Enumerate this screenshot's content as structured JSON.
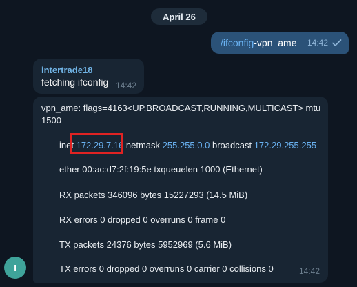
{
  "date_separator": "April 26",
  "outgoing_message": {
    "command_link": "/ifconfig",
    "command_rest": "-vpn_ame",
    "time": "14:42",
    "status_icon": "double-check-icon"
  },
  "incoming_message_1": {
    "sender": "intertrade18",
    "text": "fetching ifconfig",
    "time": "14:42"
  },
  "incoming_message_2": {
    "line1": "vpn_ame: flags=4163<UP,BROADCAST,RUNNING,MULTICAST>  mtu",
    "line2": "1500",
    "inet_label": "inet",
    "inet_ip": "172.29.7.16",
    "netmask_label": "netmask",
    "netmask_ip": "255.255.0.0",
    "broadcast_label": "broadcast",
    "broadcast_ip": "172.29.255.255",
    "ether_line": "ether 00:ac:d7:2f:19:5e  txqueuelen 1000  (Ethernet)",
    "rx_packets_line": "RX packets 346096  bytes 15227293 (14.5 MiB)",
    "rx_errors_line": "RX errors 0  dropped 0  overruns 0  frame 0",
    "tx_packets_line": "TX packets 24376  bytes 5952969 (5.6 MiB)",
    "tx_errors_line": "TX errors 0  dropped 0 overruns 0  carrier 0  collisions 0",
    "time": "14:42"
  },
  "avatar": {
    "initial": "I",
    "color": "#3fa39a"
  },
  "colors": {
    "background": "#0e1621",
    "incoming_bubble": "#182533",
    "outgoing_bubble": "#2b5278",
    "link": "#6ab3f3",
    "sender_name": "#71b5e7",
    "highlight": "#e02323"
  }
}
